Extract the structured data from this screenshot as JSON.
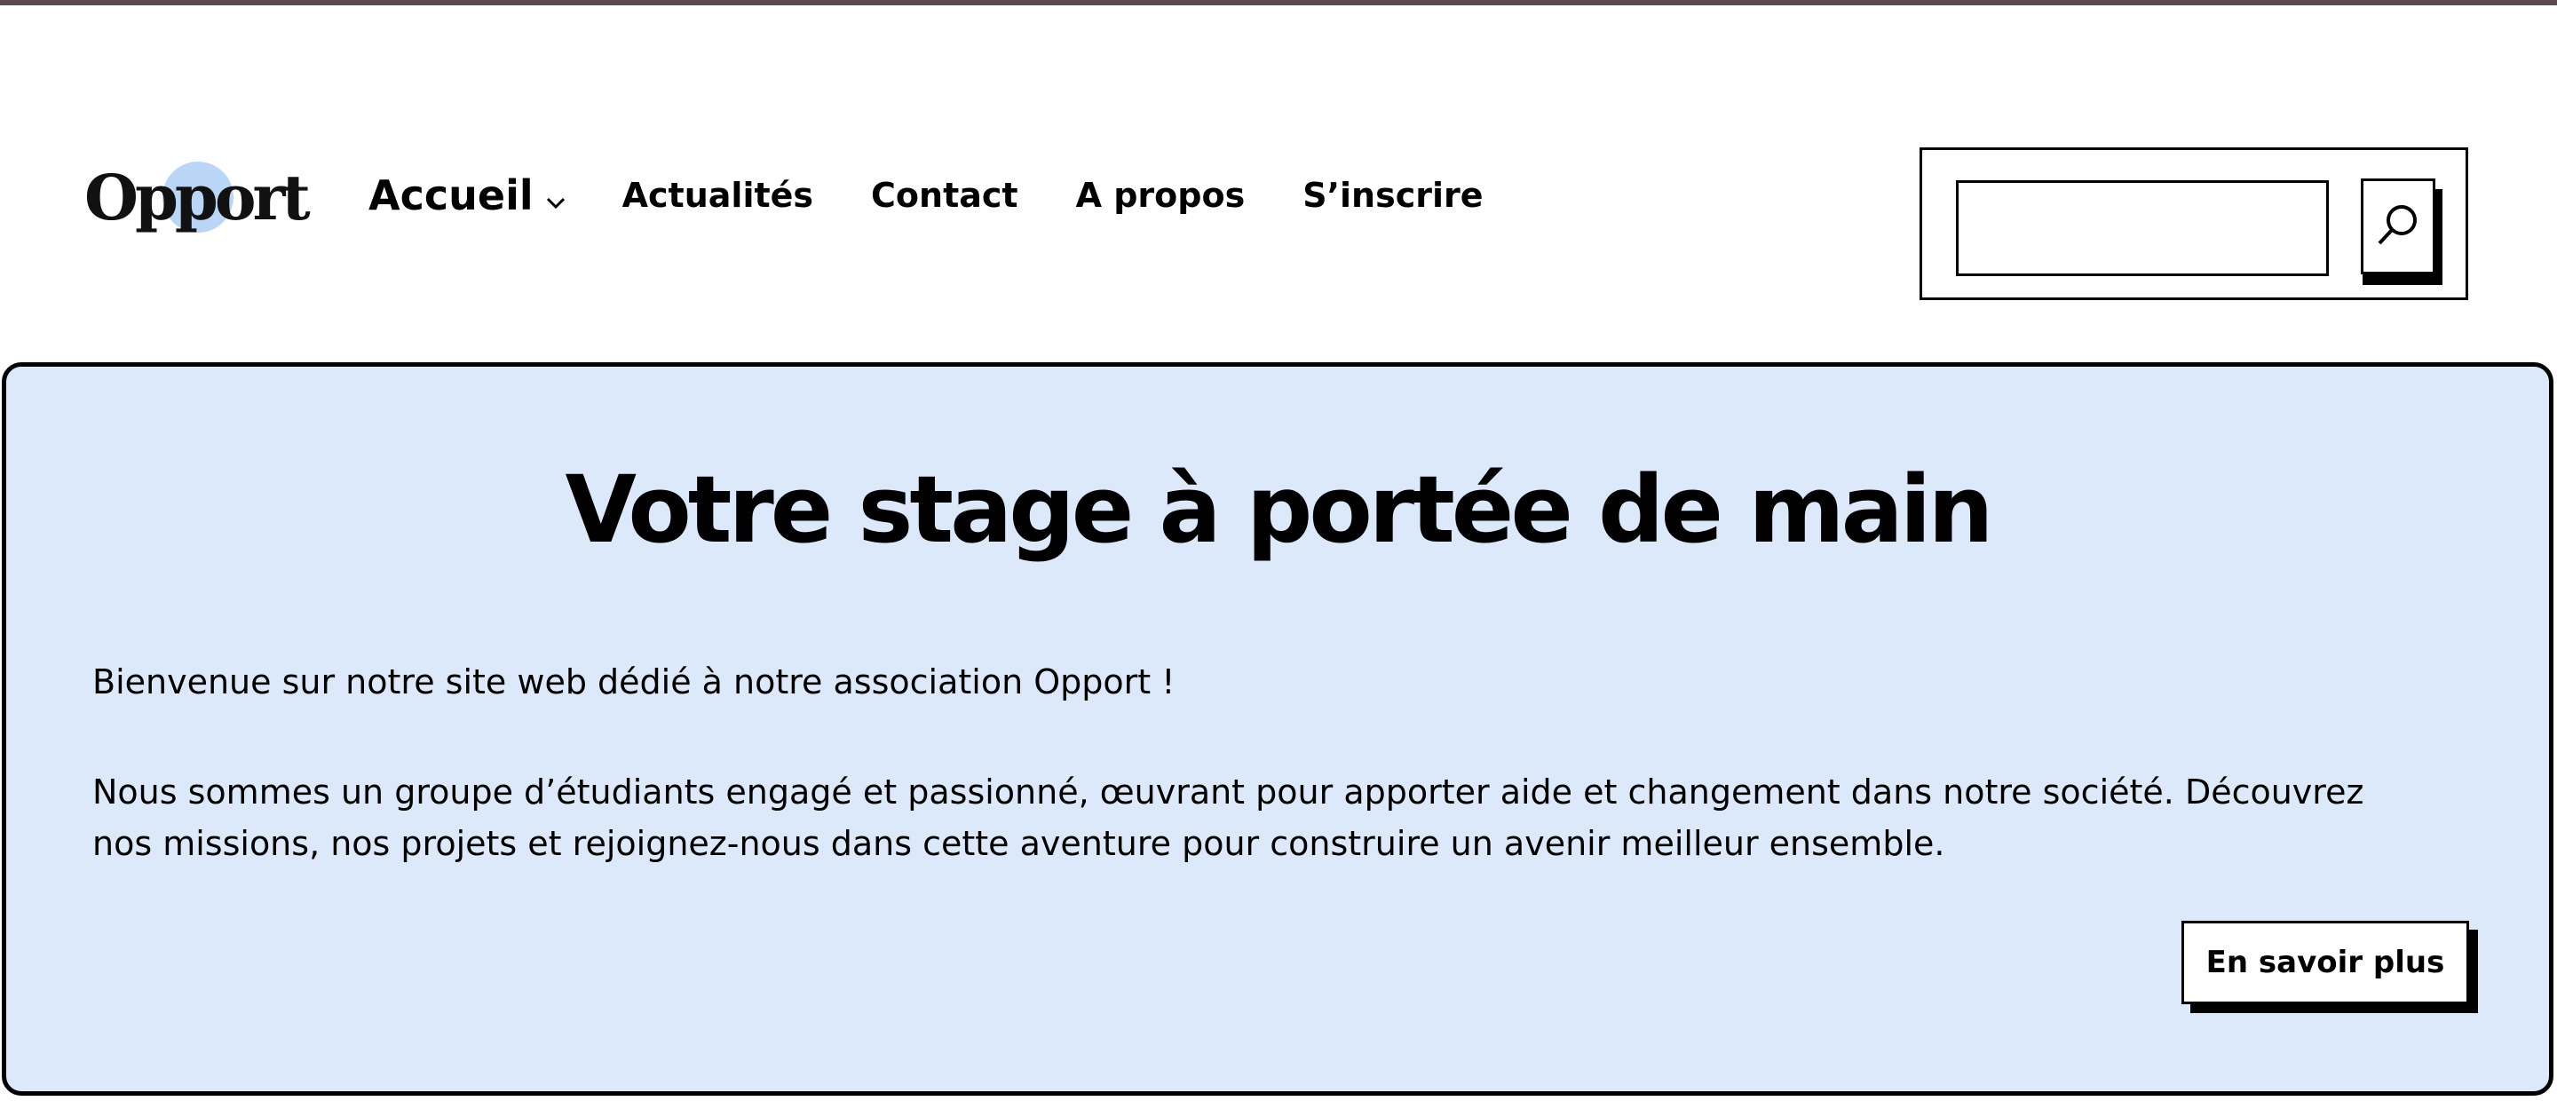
{
  "header": {
    "logo_text": "Opport",
    "nav": [
      {
        "label": "Accueil",
        "has_dropdown": true,
        "icon": "chevron-down-icon"
      },
      {
        "label": "Actualités"
      },
      {
        "label": "Contact"
      },
      {
        "label": "A propos"
      },
      {
        "label": "S’inscrire"
      }
    ],
    "search": {
      "value": "",
      "placeholder": "",
      "button_icon": "search-icon"
    }
  },
  "hero": {
    "title": "Votre stage à portée de main",
    "paragraph1": "Bienvenue sur notre site web dédié à notre association Opport !",
    "paragraph2": "Nous sommes un groupe d’étudiants engagé et passionné, œuvrant pour apporter aide et changement dans notre société. Découvrez nos missions, nos projets et rejoignez-nous dans cette aventure pour construire un avenir meilleur ensemble.",
    "cta_label": "En savoir plus"
  },
  "colors": {
    "hero_background": "#dbe9fb",
    "logo_accent": "#b9d6f6",
    "top_bar": "#5b4a4c",
    "border": "#000000"
  }
}
